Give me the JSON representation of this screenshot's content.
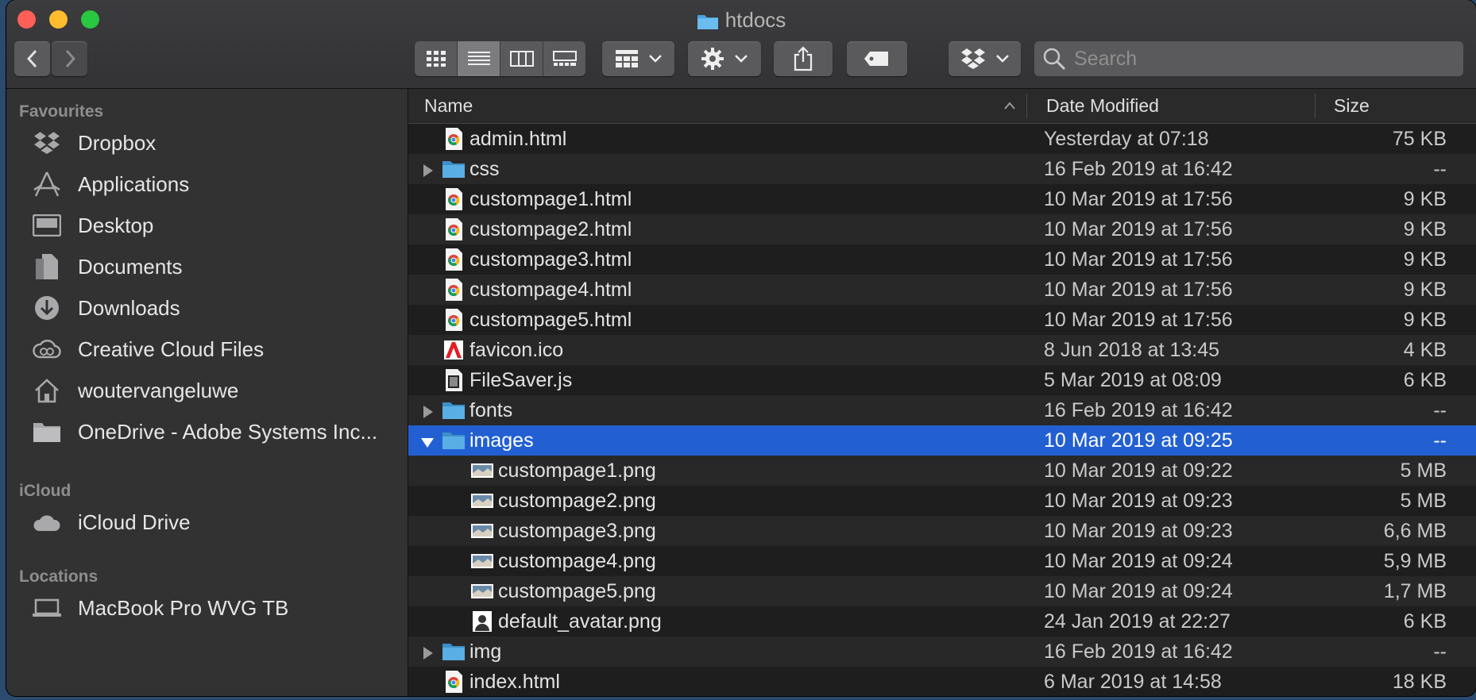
{
  "window": {
    "title": "htdocs"
  },
  "toolbar": {
    "search_placeholder": "Search"
  },
  "sidebar": {
    "favourites_label": "Favourites",
    "favourites": [
      {
        "label": "Dropbox",
        "icon": "dropbox-icon"
      },
      {
        "label": "Applications",
        "icon": "applications-icon"
      },
      {
        "label": "Desktop",
        "icon": "desktop-icon"
      },
      {
        "label": "Documents",
        "icon": "documents-icon"
      },
      {
        "label": "Downloads",
        "icon": "downloads-icon"
      },
      {
        "label": "Creative Cloud Files",
        "icon": "creative-cloud-icon"
      },
      {
        "label": "woutervangeluwe",
        "icon": "home-icon"
      },
      {
        "label": "OneDrive - Adobe Systems Inc...",
        "icon": "folder-icon"
      }
    ],
    "icloud_label": "iCloud",
    "icloud": [
      {
        "label": "iCloud Drive",
        "icon": "cloud-icon"
      }
    ],
    "locations_label": "Locations",
    "locations": [
      {
        "label": "MacBook Pro WVG TB",
        "icon": "laptop-icon"
      }
    ]
  },
  "columns": {
    "name": "Name",
    "date": "Date Modified",
    "size": "Size"
  },
  "files": [
    {
      "name": "admin.html",
      "date": "Yesterday at 07:18",
      "size": "75 KB",
      "type": "html",
      "level": 0
    },
    {
      "name": "css",
      "date": "16 Feb 2019 at 16:42",
      "size": "--",
      "type": "folder",
      "level": 0,
      "expanded": false
    },
    {
      "name": "custompage1.html",
      "date": "10 Mar 2019 at 17:56",
      "size": "9 KB",
      "type": "html",
      "level": 0
    },
    {
      "name": "custompage2.html",
      "date": "10 Mar 2019 at 17:56",
      "size": "9 KB",
      "type": "html",
      "level": 0
    },
    {
      "name": "custompage3.html",
      "date": "10 Mar 2019 at 17:56",
      "size": "9 KB",
      "type": "html",
      "level": 0
    },
    {
      "name": "custompage4.html",
      "date": "10 Mar 2019 at 17:56",
      "size": "9 KB",
      "type": "html",
      "level": 0
    },
    {
      "name": "custompage5.html",
      "date": "10 Mar 2019 at 17:56",
      "size": "9 KB",
      "type": "html",
      "level": 0
    },
    {
      "name": "favicon.ico",
      "date": "8 Jun 2018 at 13:45",
      "size": "4 KB",
      "type": "ico",
      "level": 0
    },
    {
      "name": "FileSaver.js",
      "date": "5 Mar 2019 at 08:09",
      "size": "6 KB",
      "type": "js",
      "level": 0
    },
    {
      "name": "fonts",
      "date": "16 Feb 2019 at 16:42",
      "size": "--",
      "type": "folder",
      "level": 0,
      "expanded": false
    },
    {
      "name": "images",
      "date": "10 Mar 2019 at 09:25",
      "size": "--",
      "type": "folder",
      "level": 0,
      "expanded": true,
      "selected": true
    },
    {
      "name": "custompage1.png",
      "date": "10 Mar 2019 at 09:22",
      "size": "5 MB",
      "type": "png",
      "level": 1
    },
    {
      "name": "custompage2.png",
      "date": "10 Mar 2019 at 09:23",
      "size": "5 MB",
      "type": "png",
      "level": 1
    },
    {
      "name": "custompage3.png",
      "date": "10 Mar 2019 at 09:23",
      "size": "6,6 MB",
      "type": "png",
      "level": 1
    },
    {
      "name": "custompage4.png",
      "date": "10 Mar 2019 at 09:24",
      "size": "5,9 MB",
      "type": "png",
      "level": 1
    },
    {
      "name": "custompage5.png",
      "date": "10 Mar 2019 at 09:24",
      "size": "1,7 MB",
      "type": "png",
      "level": 1
    },
    {
      "name": "default_avatar.png",
      "date": "24 Jan 2019 at 22:27",
      "size": "6 KB",
      "type": "avatar",
      "level": 1
    },
    {
      "name": "img",
      "date": "16 Feb 2019 at 16:42",
      "size": "--",
      "type": "folder",
      "level": 0,
      "expanded": false
    },
    {
      "name": "index.html",
      "date": "6 Mar 2019 at 14:58",
      "size": "18 KB",
      "type": "html",
      "level": 0
    }
  ],
  "colors": {
    "selection": "#2260d2",
    "folder": "#4aa3df",
    "close": "#fe5f57",
    "minimize": "#febc2e",
    "maximize": "#28c840"
  }
}
